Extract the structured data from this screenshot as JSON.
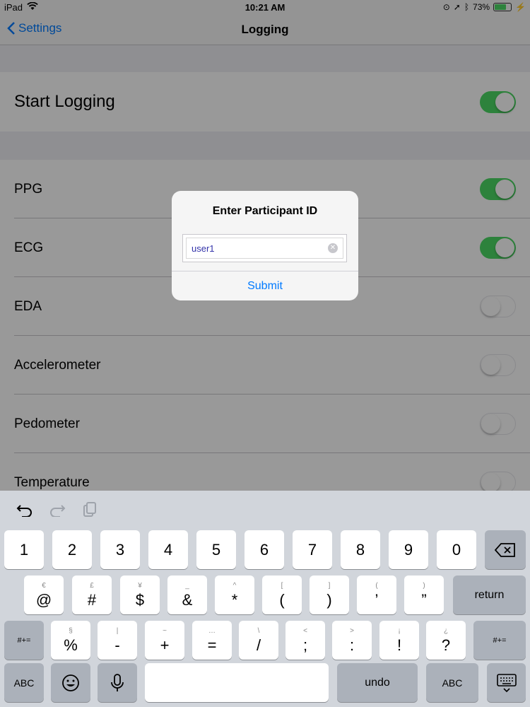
{
  "status_bar": {
    "device": "iPad",
    "time": "10:21 AM",
    "battery_percent": "73%",
    "battery_level": 0.73
  },
  "nav": {
    "back_label": "Settings",
    "title": "Logging"
  },
  "start_logging": {
    "label": "Start Logging",
    "on": true
  },
  "sensors": [
    {
      "label": "PPG",
      "on": true
    },
    {
      "label": "ECG",
      "on": true
    },
    {
      "label": "EDA",
      "on": false
    },
    {
      "label": "Accelerometer",
      "on": false
    },
    {
      "label": "Pedometer",
      "on": false
    },
    {
      "label": "Temperature",
      "on": false
    }
  ],
  "alert": {
    "title": "Enter Participant ID",
    "input_value": "user1",
    "submit_label": "Submit"
  },
  "keyboard": {
    "row1": [
      "1",
      "2",
      "3",
      "4",
      "5",
      "6",
      "7",
      "8",
      "9",
      "0"
    ],
    "row2": [
      {
        "main": "@",
        "sub": "€"
      },
      {
        "main": "#",
        "sub": "£"
      },
      {
        "main": "$",
        "sub": "¥"
      },
      {
        "main": "&",
        "sub": "_"
      },
      {
        "main": "*",
        "sub": "^"
      },
      {
        "main": "(",
        "sub": "["
      },
      {
        "main": ")",
        "sub": "]"
      },
      {
        "main": "’",
        "sub": "("
      },
      {
        "main": "”",
        "sub": ")"
      }
    ],
    "row3": [
      {
        "main": "%",
        "sub": "§"
      },
      {
        "main": "-",
        "sub": "|"
      },
      {
        "main": "+",
        "sub": "~"
      },
      {
        "main": "=",
        "sub": "…"
      },
      {
        "main": "/",
        "sub": "\\"
      },
      {
        "main": ";",
        "sub": "<"
      },
      {
        "main": ":",
        "sub": ">"
      },
      {
        "main": "!",
        "sub": "¡"
      },
      {
        "main": "?",
        "sub": "¿"
      }
    ],
    "return_label": "return",
    "symbols_label": "#+=",
    "abc_label": "ABC",
    "undo_label": "undo"
  }
}
